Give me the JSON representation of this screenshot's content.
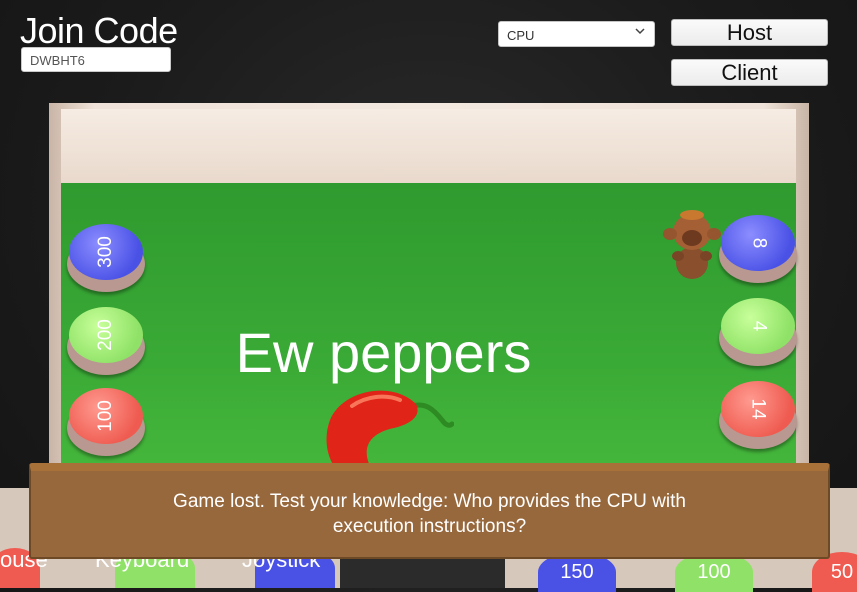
{
  "header": {
    "join_title": "Join Code",
    "join_code": "DWBHT6",
    "select_value": "CPU",
    "host_label": "Host",
    "client_label": "Client"
  },
  "board": {
    "title": "Ew peppers",
    "left_pads": [
      {
        "value": "300",
        "color": "blue"
      },
      {
        "value": "200",
        "color": "green"
      },
      {
        "value": "100",
        "color": "red"
      }
    ],
    "right_pads": [
      {
        "value": "8",
        "color": "blue"
      },
      {
        "value": "4",
        "color": "green"
      },
      {
        "value": "14",
        "color": "red"
      }
    ]
  },
  "dialog": {
    "message": "Game lost. Test your knowledge: Who provides the CPU with execution instructions?"
  },
  "background_answers": {
    "labels": [
      "ouse",
      "Keyboard",
      "Joystick"
    ],
    "pads": [
      "150",
      "100",
      "50"
    ]
  },
  "colors": {
    "blue": "#4a52e6",
    "green": "#8fe267",
    "red": "#ef5b50",
    "board_green": "#3aaa36",
    "dialog_brown": "#98683d"
  }
}
